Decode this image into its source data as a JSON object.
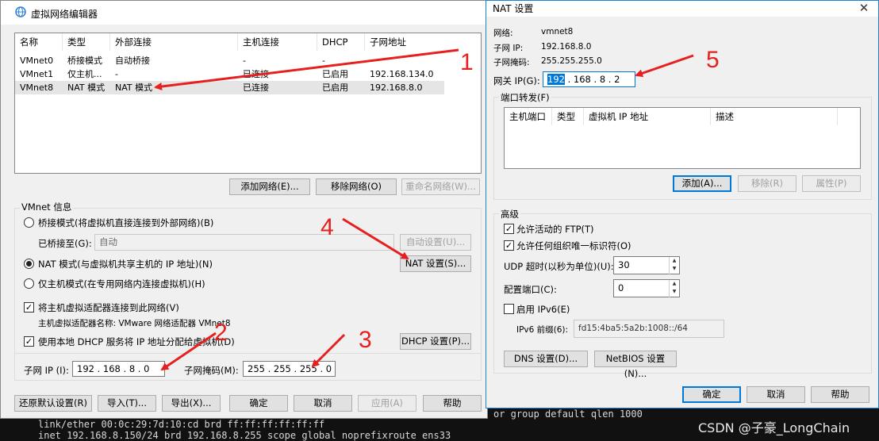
{
  "terminal": {
    "line1": "link/ether 00:0c:29:7d:10:cd brd ff:ff:ff:ff:ff:ff",
    "line2": "inet 192.168.8.150/24 brd 192.168.8.255 scope global noprefixroute ens33",
    "right_fragment": "or group default qlen 1000"
  },
  "watermark": "CSDN @子豪_LongChain",
  "vne": {
    "title": "虚拟网络编辑器",
    "close": "✕",
    "table": {
      "headers": [
        "名称",
        "类型",
        "外部连接",
        "主机连接",
        "DHCP",
        "子网地址"
      ],
      "rows": [
        [
          "VMnet0",
          "桥接模式",
          "自动桥接",
          "-",
          "-",
          ""
        ],
        [
          "VMnet1",
          "仅主机...",
          "-",
          "已连接",
          "已启用",
          "192.168.134.0"
        ],
        [
          "VMnet8",
          "NAT 模式",
          "NAT 模式",
          "已连接",
          "已启用",
          "192.168.8.0"
        ]
      ]
    },
    "btn_add": "添加网络(E)...",
    "btn_remove": "移除网络(O)",
    "btn_rename": "重命名网络(W)...",
    "vmnet_info": "VMnet 信息",
    "radio_bridge": "桥接模式(将虚拟机直接连接到外部网络)(B)",
    "bridged_to_label": "已桥接至(G):",
    "bridged_to_value": "自动",
    "btn_auto": "自动设置(U)...",
    "radio_nat": "NAT 模式(与虚拟机共享主机的 IP 地址)(N)",
    "btn_nat": "NAT 设置(S)...",
    "radio_host": "仅主机模式(在专用网络内连接虚拟机)(H)",
    "check_connect": "将主机虚拟适配器连接到此网络(V)",
    "adapter_name": "主机虚拟适配器名称: VMware 网络适配器 VMnet8",
    "check_dhcp": "使用本地 DHCP 服务将 IP 地址分配给虚拟机(D)",
    "btn_dhcp": "DHCP 设置(P)...",
    "subnet_ip_label": "子网 IP (I):",
    "subnet_ip_value": "192 . 168 . 8 . 0",
    "mask_label": "子网掩码(M):",
    "mask_value": "255 . 255 . 255 . 0",
    "btn_restore": "还原默认设置(R)",
    "btn_import": "导入(T)...",
    "btn_export": "导出(X)...",
    "btn_ok": "确定",
    "btn_cancel": "取消",
    "btn_apply": "应用(A)",
    "btn_help": "帮助"
  },
  "nat": {
    "title": "NAT 设置",
    "close": "✕",
    "network_label": "网络:",
    "network_value": "vmnet8",
    "subnet_ip_label": "子网 IP:",
    "subnet_ip_value": "192.168.8.0",
    "mask_label": "子网掩码:",
    "mask_value": "255.255.255.0",
    "gateway_label": "网关 IP(G):",
    "gateway_first": "192",
    "gateway_rest": " . 168 . 8 . 2",
    "port_forward": "端口转发(F)",
    "pf_headers": [
      "主机端口",
      "类型",
      "虚拟机 IP 地址",
      "描述"
    ],
    "btn_add": "添加(A)...",
    "btn_remove": "移除(R)",
    "btn_props": "属性(P)",
    "advanced": "高级",
    "check_ftp": "允许活动的 FTP(T)",
    "check_uid": "允许任何组织唯一标识符(O)",
    "udp_label": "UDP 超时(以秒为单位)(U):",
    "udp_value": "30",
    "port_label": "配置端口(C):",
    "port_value": "0",
    "check_ipv6": "启用 IPv6(E)",
    "ipv6_prefix_label": "IPv6 前缀(6):",
    "ipv6_prefix_value": "fd15:4ba5:5a2b:1008::/64",
    "btn_dns": "DNS 设置(D)...",
    "btn_netbios": "NetBIOS 设置(N)...",
    "btn_ok": "确定",
    "btn_cancel": "取消",
    "btn_help": "帮助"
  },
  "annotations": [
    "1",
    "2",
    "3",
    "4",
    "5"
  ],
  "accent_color": "#e5201f"
}
